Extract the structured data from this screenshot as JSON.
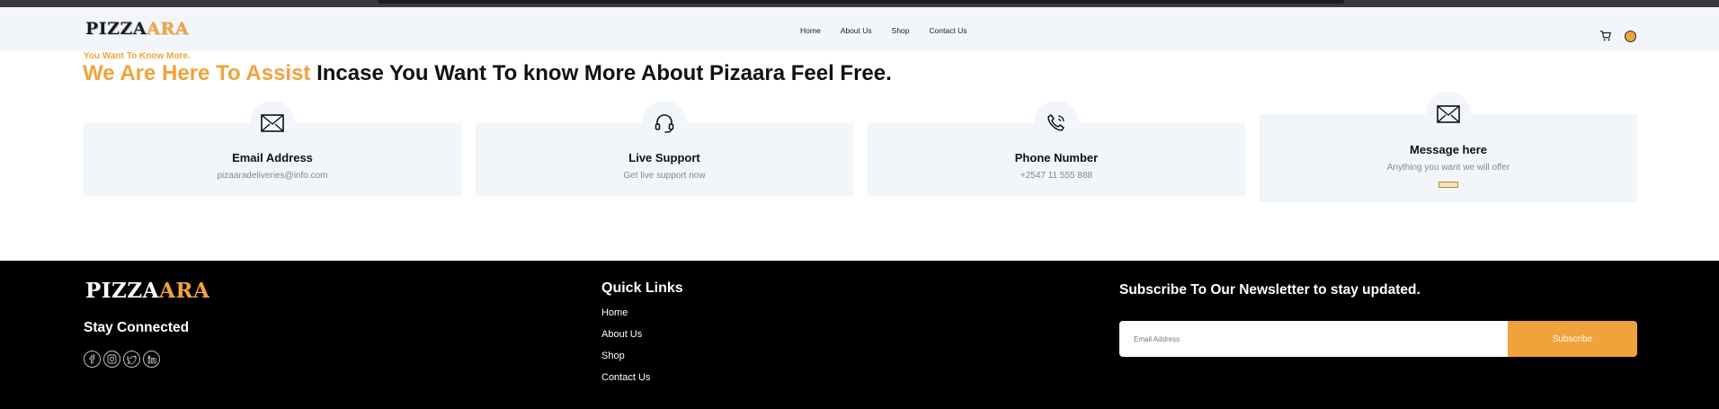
{
  "nav": {
    "logo_part1": "PIZZA",
    "logo_part2": "ARA",
    "links": [
      "Home",
      "About Us",
      "Shop",
      "Contact Us"
    ],
    "icons": [
      "cart-icon",
      "avatar"
    ]
  },
  "hero": {
    "eyebrow": "You Want To Know More.",
    "headline_highlight": "We Are Here To Assist",
    "headline_rest": " Incase You Want To know More About Pizaara Feel Free."
  },
  "cards": [
    {
      "icon": "mail-icon",
      "title": "Email Address",
      "subtitle": "pizaaradeliveries@info.com"
    },
    {
      "icon": "headset-icon",
      "title": "Live Support",
      "subtitle": "Get live support now"
    },
    {
      "icon": "phone-icon",
      "title": "Phone Number",
      "subtitle": "+2547 11 555 888"
    },
    {
      "icon": "mail-icon",
      "title": "Message here",
      "subtitle": "Anything you want we will offer"
    }
  ],
  "footer": {
    "logo_part1": "PIZZA",
    "logo_part2": "ARA",
    "stay_connected": "Stay Connected",
    "socials": [
      "facebook-icon",
      "instagram-icon",
      "twitter-icon",
      "linkedin-icon"
    ],
    "quick_links_title": "Quick Links",
    "quick_links": [
      "Home",
      "About Us",
      "Shop",
      "Contact Us"
    ],
    "newsletter_title": "Subscribe To Our Newsletter to stay updated.",
    "email_placeholder": "Email Address",
    "subscribe_label": "Subscribe"
  },
  "colors": {
    "accent": "#f0a33b",
    "nav_bg": "#f2f5f9",
    "footer_bg": "#000000"
  }
}
